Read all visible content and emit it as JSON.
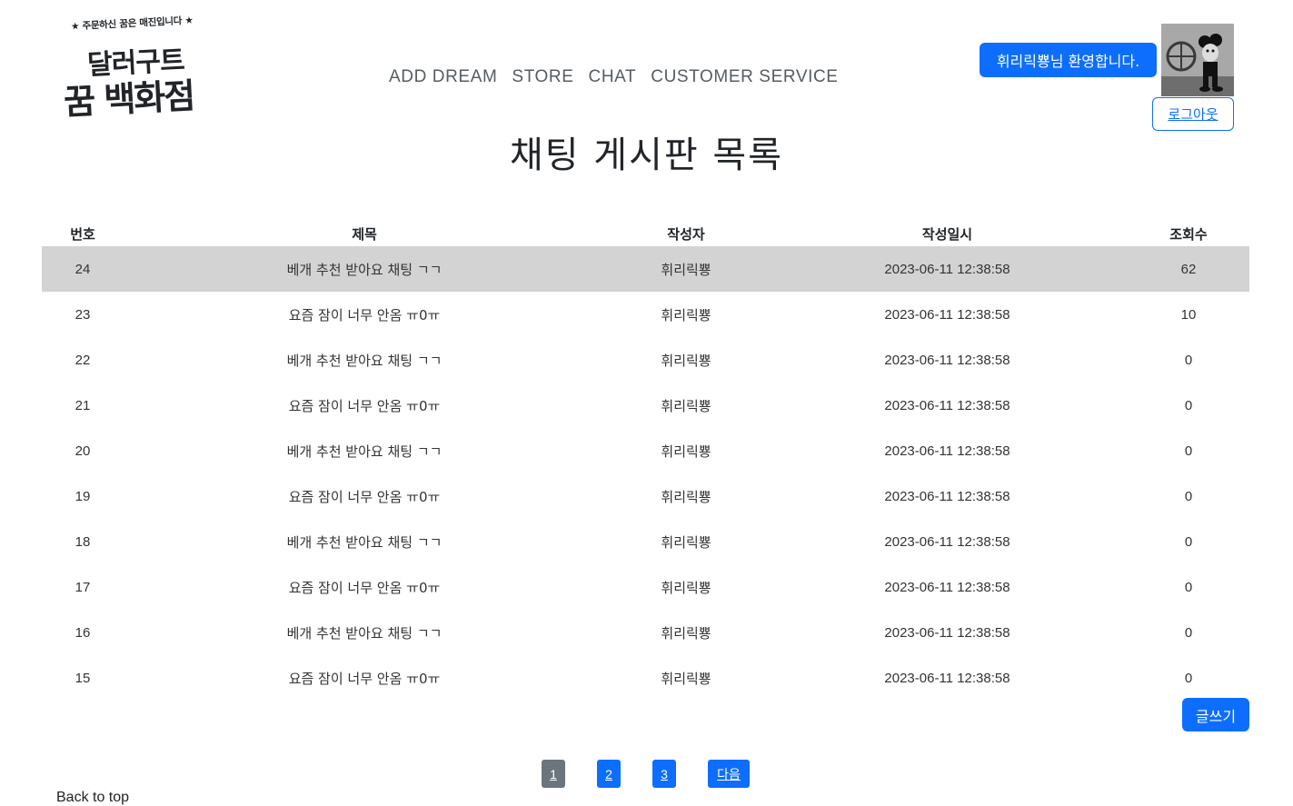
{
  "header": {
    "logo": {
      "tagline": "★ 주문하신 꿈은 매진입니다 ★",
      "line1": "달러구트",
      "line2": "꿈 백화점"
    },
    "nav": [
      "ADD DREAM",
      "STORE",
      "CHAT",
      "CUSTOMER SERVICE"
    ],
    "welcome": "휘리릭뿅님 환영합니다.",
    "logout": "로그아웃"
  },
  "page_title": "채팅 게시판 목록",
  "table": {
    "columns": [
      "번호",
      "제목",
      "작성자",
      "작성일시",
      "조회수"
    ],
    "rows": [
      {
        "no": "24",
        "title": "베개 추천 받아요 채팅 ㄱㄱ",
        "writer": "휘리릭뿅",
        "date": "2023-06-11 12:38:58",
        "views": "62"
      },
      {
        "no": "23",
        "title": "요즘 잠이 너무 안옴 ㅠ0ㅠ",
        "writer": "휘리릭뿅",
        "date": "2023-06-11 12:38:58",
        "views": "10"
      },
      {
        "no": "22",
        "title": "베개 추천 받아요 채팅 ㄱㄱ",
        "writer": "휘리릭뿅",
        "date": "2023-06-11 12:38:58",
        "views": "0"
      },
      {
        "no": "21",
        "title": "요즘 잠이 너무 안옴 ㅠ0ㅠ",
        "writer": "휘리릭뿅",
        "date": "2023-06-11 12:38:58",
        "views": "0"
      },
      {
        "no": "20",
        "title": "베개 추천 받아요 채팅 ㄱㄱ",
        "writer": "휘리릭뿅",
        "date": "2023-06-11 12:38:58",
        "views": "0"
      },
      {
        "no": "19",
        "title": "요즘 잠이 너무 안옴 ㅠ0ㅠ",
        "writer": "휘리릭뿅",
        "date": "2023-06-11 12:38:58",
        "views": "0"
      },
      {
        "no": "18",
        "title": "베개 추천 받아요 채팅 ㄱㄱ",
        "writer": "휘리릭뿅",
        "date": "2023-06-11 12:38:58",
        "views": "0"
      },
      {
        "no": "17",
        "title": "요즘 잠이 너무 안옴 ㅠ0ㅠ",
        "writer": "휘리릭뿅",
        "date": "2023-06-11 12:38:58",
        "views": "0"
      },
      {
        "no": "16",
        "title": "베개 추천 받아요 채팅 ㄱㄱ",
        "writer": "휘리릭뿅",
        "date": "2023-06-11 12:38:58",
        "views": "0"
      },
      {
        "no": "15",
        "title": "요즘 잠이 너무 안옴 ㅠ0ㅠ",
        "writer": "휘리릭뿅",
        "date": "2023-06-11 12:38:58",
        "views": "0"
      }
    ]
  },
  "write_button": "글쓰기",
  "pagination": {
    "pages": [
      "1",
      "2",
      "3"
    ],
    "current": "1",
    "next": "다음"
  },
  "footer": {
    "back_to_top": "Back to top"
  },
  "colors": {
    "primary": "#0d6efd",
    "secondary": "#6c757d",
    "highlight_row": "#d3d3d3"
  }
}
